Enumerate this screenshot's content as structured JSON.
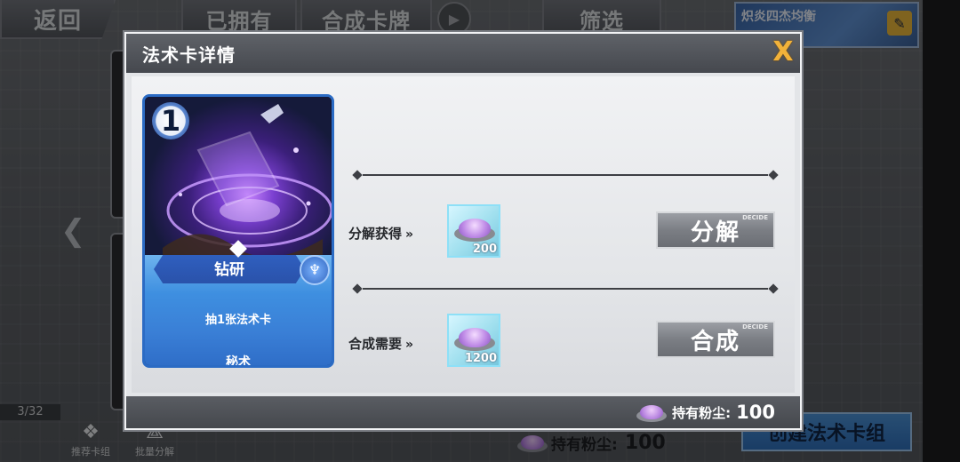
{
  "background": {
    "back_label": "返回",
    "owned_label": "已拥有",
    "craft_tab_label": "合成卡牌",
    "filter_label": "筛选",
    "deck_name": "炽炎四杰均衡",
    "page_count": "3/32",
    "recommend_label": "推荐卡组",
    "batch_decompose_label": "批量分解",
    "dust_label": "持有粉尘:",
    "dust_value": "100",
    "create_deck_label": "创建法术卡组"
  },
  "dialog": {
    "title": "法术卡详情",
    "close_label": "X",
    "card": {
      "cost": "1",
      "type": "钻研",
      "description": "抽1张法术卡",
      "rarity": "秘术"
    },
    "decompose": {
      "label": "分解获得",
      "amount": "200",
      "button_label": "分解",
      "button_tag": "DECIDE"
    },
    "craft": {
      "label": "合成需要",
      "amount": "1200",
      "button_label": "合成",
      "button_tag": "DECIDE"
    },
    "footer": {
      "dust_label": "持有粉尘:",
      "dust_value": "100"
    }
  },
  "colors": {
    "accent_close": "#f2b23a",
    "card_border": "#2b6bc4",
    "dust_slot": "#9fdfee"
  }
}
